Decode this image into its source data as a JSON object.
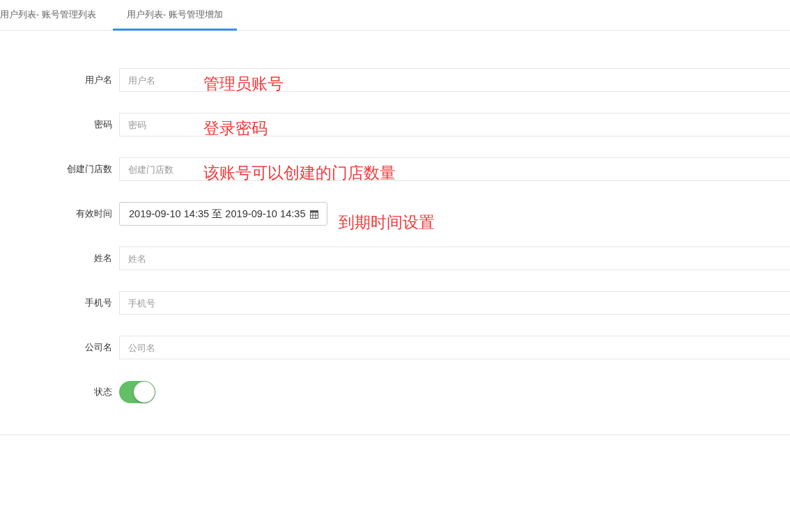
{
  "tabs": [
    {
      "label": "用户列表- 账号管理列表",
      "selected": false
    },
    {
      "label": "用户列表- 账号管理增加",
      "selected": true
    }
  ],
  "form": {
    "fields": [
      {
        "kind": "text",
        "label": "用户名",
        "placeholder": "用户名",
        "annotation": "管理员账号"
      },
      {
        "kind": "text",
        "label": "密码",
        "placeholder": "密码",
        "annotation": "登录密码"
      },
      {
        "kind": "text",
        "label": "创建门店数",
        "placeholder": "创建门店数",
        "annotation": "该账号可以创建的门店数量"
      },
      {
        "kind": "daterange",
        "label": "有效时间",
        "value": "2019-09-10 14:35 至 2019-09-10 14:35",
        "annotation": "到期时间设置"
      },
      {
        "kind": "text",
        "label": "姓名",
        "placeholder": "姓名"
      },
      {
        "kind": "text",
        "label": "手机号",
        "placeholder": "手机号"
      },
      {
        "kind": "text",
        "label": "公司名",
        "placeholder": "公司名"
      },
      {
        "kind": "switch",
        "label": "状态",
        "on": true
      }
    ]
  }
}
